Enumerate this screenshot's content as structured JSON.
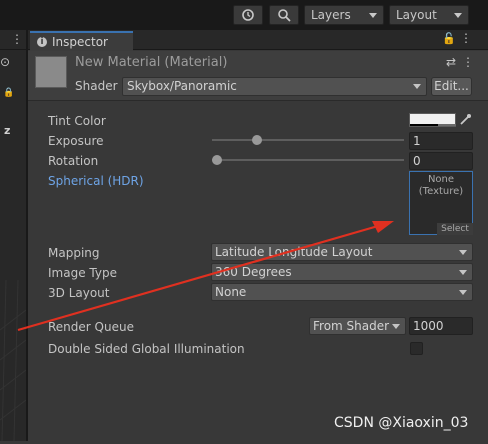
{
  "toolbar": {
    "history_icon": "history-icon",
    "search_icon": "search-icon",
    "layers_label": "Layers",
    "layout_label": "Layout"
  },
  "tab": {
    "label": "Inspector"
  },
  "material": {
    "name": "New Material (Material)",
    "shader_label": "Shader",
    "shader_value": "Skybox/Panoramic",
    "edit_label": "Edit..."
  },
  "properties": {
    "tint_color_label": "Tint Color",
    "tint_color_value": "#f0f0f0",
    "exposure_label": "Exposure",
    "exposure_value": "1",
    "exposure_slider_fraction": 0.14,
    "rotation_label": "Rotation",
    "rotation_value": "0",
    "rotation_slider_fraction": 0.0,
    "spherical_label": "Spherical  (HDR)",
    "texture_none": "None",
    "texture_type": "(Texture)",
    "texture_select": "Select",
    "mapping_label": "Mapping",
    "mapping_value": "Latitude Longitude Layout",
    "image_type_label": "Image Type",
    "image_type_value": "360 Degrees",
    "layout_3d_label": "3D Layout",
    "layout_3d_value": "None",
    "render_queue_label": "Render Queue",
    "render_queue_mode": "From Shader",
    "render_queue_value": "1000",
    "double_sided_label": "Double Sided Global Illumination",
    "double_sided_checked": false
  },
  "colors": {
    "accent": "#3a72b0",
    "spherical_label": "#6ea4e6",
    "annotation_arrow": "#e03020"
  },
  "watermark": "CSDN @Xiaoxin_03"
}
